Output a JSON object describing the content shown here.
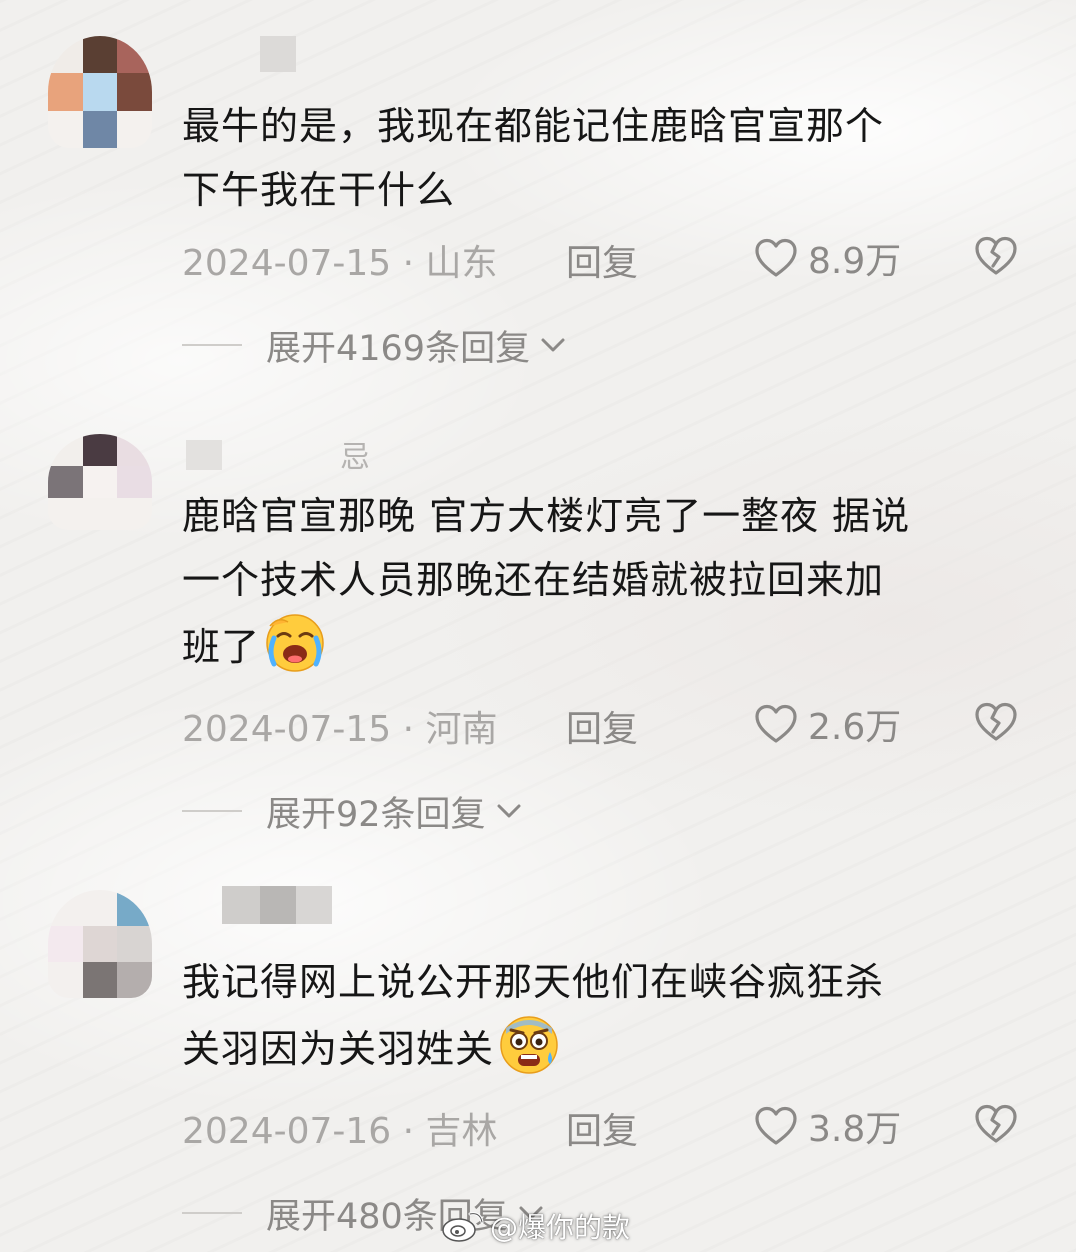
{
  "comments": [
    {
      "text": "最牛的是，我现在都能记住鹿晗官宣那个下午我在干什么",
      "line1": "最牛的是，我现在都能记住鹿晗官宣那个",
      "line2": "下午我在干什么",
      "line3": "",
      "date_location": "2024-07-15 · 山东",
      "reply_label": "回复",
      "likes": "8.9万",
      "expand_label": "展开4169条回复",
      "emoji": ""
    },
    {
      "username_fragment": "忌",
      "line1": "鹿晗官宣那晚 官方大楼灯亮了一整夜 据说",
      "line2": "一个技术人员那晚还在结婚就被拉回来加",
      "line3": "班了",
      "date_location": "2024-07-15 · 河南",
      "reply_label": "回复",
      "likes": "2.6万",
      "expand_label": "展开92条回复",
      "emoji": "loudly-crying-face-icon"
    },
    {
      "line1": "我记得网上说公开那天他们在峡谷疯狂杀",
      "line2": "关羽因为关羽姓关",
      "date_location": "2024-07-16 · 吉林",
      "reply_label": "回复",
      "likes": "3.8万",
      "expand_label": "展开480条回复",
      "emoji": "fearful-face-icon"
    }
  ],
  "watermark": {
    "text": "@爆你的款",
    "icon": "weibo-logo-icon"
  },
  "colors": {
    "text": "#161616",
    "meta": "#a9a7a5",
    "action": "#8b8987"
  }
}
